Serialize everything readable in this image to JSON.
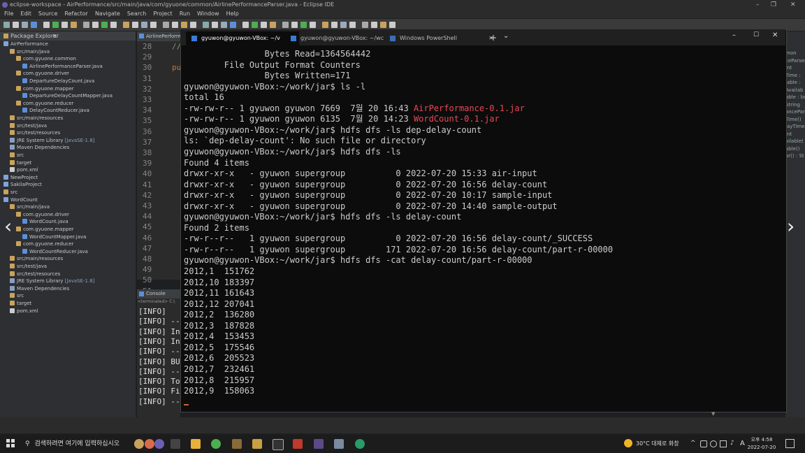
{
  "eclipse": {
    "title": "eclipse-workspace - AirPerformance/src/main/java/com/gyuone/common/AirlinePerformanceParser.java - Eclipse IDE",
    "menu": [
      "File",
      "Edit",
      "Source",
      "Refactor",
      "Navigate",
      "Search",
      "Project",
      "Run",
      "Window",
      "Help"
    ],
    "package_explorer": {
      "title": "Package Explorer",
      "items": [
        {
          "label": "AirPerformance",
          "indent": 0,
          "color": "#7fa4d9"
        },
        {
          "label": "src/main/java",
          "indent": 1,
          "color": "#c9a35b"
        },
        {
          "label": "com.gyuone.common",
          "indent": 2,
          "color": "#c9a35b"
        },
        {
          "label": "AirlinePerformanceParser.java",
          "indent": 3,
          "color": "#5b8fd9"
        },
        {
          "label": "com.gyuone.driver",
          "indent": 2,
          "color": "#c9a35b"
        },
        {
          "label": "DepartureDelayCount.java",
          "indent": 3,
          "color": "#5b8fd9"
        },
        {
          "label": "com.gyuone.mapper",
          "indent": 2,
          "color": "#c9a35b"
        },
        {
          "label": "DepartureDelayCountMapper.java",
          "indent": 3,
          "color": "#5b8fd9"
        },
        {
          "label": "com.gyuone.reducer",
          "indent": 2,
          "color": "#c9a35b"
        },
        {
          "label": "DelayCountReducer.java",
          "indent": 3,
          "color": "#5b8fd9"
        },
        {
          "label": "src/main/resources",
          "indent": 1,
          "color": "#c9a35b"
        },
        {
          "label": "src/test/java",
          "indent": 1,
          "color": "#c9a35b"
        },
        {
          "label": "src/test/resources",
          "indent": 1,
          "color": "#c9a35b"
        },
        {
          "label": "JRE System Library",
          "extra": "[JavaSE-1.8]",
          "indent": 1,
          "color": "#8a9fbf"
        },
        {
          "label": "Maven Dependencies",
          "indent": 1,
          "color": "#8a9fbf"
        },
        {
          "label": "src",
          "indent": 1,
          "color": "#c9a35b"
        },
        {
          "label": "target",
          "indent": 1,
          "color": "#c9a35b"
        },
        {
          "label": "pom.xml",
          "indent": 1,
          "color": "#cccccc"
        },
        {
          "label": "NewProject",
          "indent": 0,
          "color": "#7fa4d9"
        },
        {
          "label": "SakilaProject",
          "indent": 0,
          "color": "#7fa4d9"
        },
        {
          "label": "src",
          "indent": 0,
          "color": "#c9a35b"
        },
        {
          "label": "WordCount",
          "indent": 0,
          "color": "#7fa4d9"
        },
        {
          "label": "src/main/java",
          "indent": 1,
          "color": "#c9a35b"
        },
        {
          "label": "com.gyuone.driver",
          "indent": 2,
          "color": "#c9a35b"
        },
        {
          "label": "WordCount.java",
          "indent": 3,
          "color": "#5b8fd9"
        },
        {
          "label": "com.gyuone.mapper",
          "indent": 2,
          "color": "#c9a35b"
        },
        {
          "label": "WordCountMapper.java",
          "indent": 3,
          "color": "#5b8fd9"
        },
        {
          "label": "com.gyuone.reducer",
          "indent": 2,
          "color": "#c9a35b"
        },
        {
          "label": "WordCountReducer.java",
          "indent": 3,
          "color": "#5b8fd9"
        },
        {
          "label": "src/main/resources",
          "indent": 1,
          "color": "#c9a35b"
        },
        {
          "label": "src/test/java",
          "indent": 1,
          "color": "#c9a35b"
        },
        {
          "label": "src/test/resources",
          "indent": 1,
          "color": "#c9a35b"
        },
        {
          "label": "JRE System Library",
          "extra": "[JavaSE-1.8]",
          "indent": 1,
          "color": "#8a9fbf"
        },
        {
          "label": "Maven Dependencies",
          "indent": 1,
          "color": "#8a9fbf"
        },
        {
          "label": "src",
          "indent": 1,
          "color": "#c9a35b"
        },
        {
          "label": "target",
          "indent": 1,
          "color": "#c9a35b"
        },
        {
          "label": "pom.xml",
          "indent": 1,
          "color": "#cccccc"
        }
      ]
    },
    "editor_tab": "AirlinePerform",
    "line_numbers": [
      "28",
      "29",
      "30",
      "31",
      "32",
      "33",
      "34",
      "35",
      "36",
      "37",
      "38",
      "39",
      "40",
      "41",
      "42",
      "43",
      "44",
      "45",
      "46",
      "47",
      "48",
      "49",
      "50",
      "51"
    ],
    "editor_fragments": {
      "line28": "//",
      "line30": "pu"
    },
    "console": {
      "title": "Console",
      "terminated": "<terminated> C:\\",
      "lines": [
        "[INFO]",
        "[INFO] ---",
        "[INFO] Ins",
        "[INFO] Ins",
        "[INFO] ---",
        "[INFO] BUI",
        "[INFO] ---",
        "[INFO] Tot",
        "[INFO] Fin",
        "[INFO] ---"
      ]
    },
    "right_panel": [
      "mon",
      "ceParser",
      "int",
      "Time :",
      "lable :",
      "Availab",
      "able : boo",
      "String",
      "anceParser",
      "Time()",
      "layTime",
      "int",
      "ailable(",
      "able()",
      "ar() : St"
    ]
  },
  "terminal": {
    "tabs": [
      {
        "label": "gyuwon@gyuwon-VBox: ~/v",
        "active": true
      },
      {
        "label": "gyuwon@gyuwon-VBox: ~/wc",
        "active": false
      },
      {
        "label": "Windows PowerShell",
        "active": false
      }
    ],
    "new_tab": "+",
    "dropdown": "⌄",
    "lines": [
      {
        "segments": [
          {
            "t": "                Bytes Read=1364564442"
          }
        ]
      },
      {
        "segments": [
          {
            "t": "        File Output Format Counters"
          }
        ]
      },
      {
        "segments": [
          {
            "t": "                Bytes Written=171"
          }
        ]
      },
      {
        "segments": [
          {
            "t": "gyuwon@gyuwon-VBox:~/work/jar$ ls -l"
          }
        ]
      },
      {
        "segments": [
          {
            "t": "total 16"
          }
        ]
      },
      {
        "segments": [
          {
            "t": "-rw-rw-r-- 1 gyuwon gyuwon 7669  7월 20 16:43 "
          },
          {
            "t": "AirPerformance-0.1.jar",
            "c": "red"
          }
        ]
      },
      {
        "segments": [
          {
            "t": "-rw-rw-r-- 1 gyuwon gyuwon 6135  7월 20 14:23 "
          },
          {
            "t": "WordCount-0.1.jar",
            "c": "red"
          }
        ]
      },
      {
        "segments": [
          {
            "t": "gyuwon@gyuwon-VBox:~/work/jar$ hdfs dfs -ls dep-delay-count"
          }
        ]
      },
      {
        "segments": [
          {
            "t": "ls: `dep-delay-count': No such file or directory"
          }
        ]
      },
      {
        "segments": [
          {
            "t": "gyuwon@gyuwon-VBox:~/work/jar$ hdfs dfs -ls"
          }
        ]
      },
      {
        "segments": [
          {
            "t": "Found 4 items"
          }
        ]
      },
      {
        "segments": [
          {
            "t": "drwxr-xr-x   - gyuwon supergroup          0 2022-07-20 15:33 air-input"
          }
        ]
      },
      {
        "segments": [
          {
            "t": "drwxr-xr-x   - gyuwon supergroup          0 2022-07-20 16:56 delay-count"
          }
        ]
      },
      {
        "segments": [
          {
            "t": "drwxr-xr-x   - gyuwon supergroup          0 2022-07-20 10:17 sample-input"
          }
        ]
      },
      {
        "segments": [
          {
            "t": "drwxr-xr-x   - gyuwon supergroup          0 2022-07-20 14:40 sample-output"
          }
        ]
      },
      {
        "segments": [
          {
            "t": "gyuwon@gyuwon-VBox:~/work/jar$ hdfs dfs -ls delay-count"
          }
        ]
      },
      {
        "segments": [
          {
            "t": "Found 2 items"
          }
        ]
      },
      {
        "segments": [
          {
            "t": "-rw-r--r--   1 gyuwon supergroup          0 2022-07-20 16:56 delay-count/_SUCCESS"
          }
        ]
      },
      {
        "segments": [
          {
            "t": "-rw-r--r--   1 gyuwon supergroup        171 2022-07-20 16:56 delay-count/part-r-00000"
          }
        ]
      },
      {
        "segments": [
          {
            "t": "gyuwon@gyuwon-VBox:~/work/jar$ hdfs dfs -cat delay-count/part-r-00000"
          }
        ]
      },
      {
        "segments": [
          {
            "t": "2012,1  151762"
          }
        ]
      },
      {
        "segments": [
          {
            "t": "2012,10 183397"
          }
        ]
      },
      {
        "segments": [
          {
            "t": "2012,11 161643"
          }
        ]
      },
      {
        "segments": [
          {
            "t": "2012,12 207041"
          }
        ]
      },
      {
        "segments": [
          {
            "t": "2012,2  136280"
          }
        ]
      },
      {
        "segments": [
          {
            "t": "2012,3  187828"
          }
        ]
      },
      {
        "segments": [
          {
            "t": "2012,4  153453"
          }
        ]
      },
      {
        "segments": [
          {
            "t": "2012,5  175546"
          }
        ]
      },
      {
        "segments": [
          {
            "t": "2012,6  205523"
          }
        ]
      },
      {
        "segments": [
          {
            "t": "2012,7  232461"
          }
        ]
      },
      {
        "segments": [
          {
            "t": "2012,8  215957"
          }
        ]
      },
      {
        "segments": [
          {
            "t": "2012,9  158063"
          }
        ]
      }
    ]
  },
  "taskbar": {
    "search_placeholder": "검색하려면 여기에 입력하십시오",
    "weather": "30°C  대체로 화창",
    "ime": "A",
    "time": "오후 4:58",
    "date": "2022-07-20"
  },
  "colors": {
    "terminal_bg": "#0c0c0c",
    "terminal_text": "#cccccc",
    "jar_red": "#e74856",
    "accent": "#3a7bd5"
  }
}
